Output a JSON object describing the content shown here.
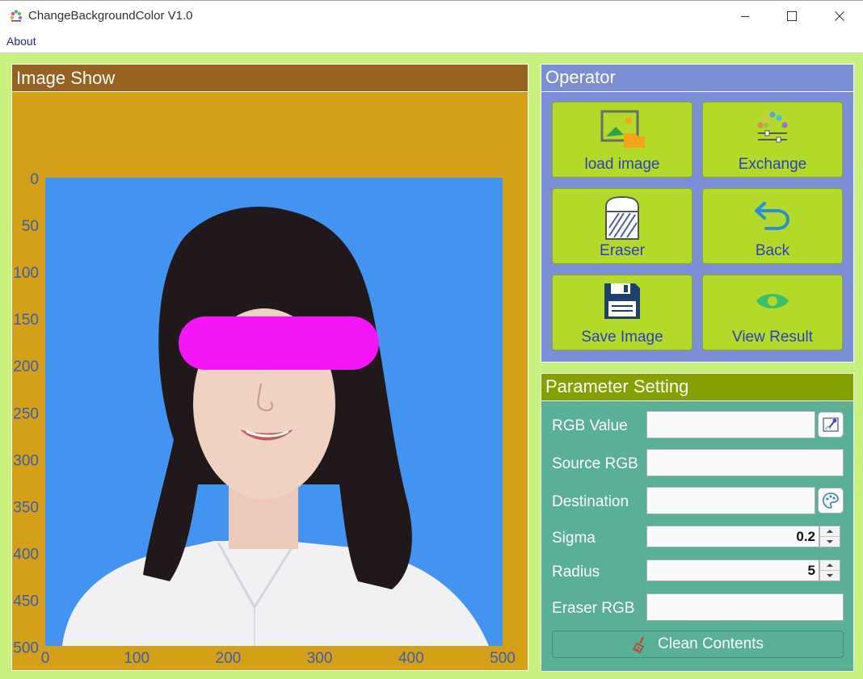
{
  "window": {
    "title": "ChangeBackgroundColor V1.0"
  },
  "menu": {
    "about": "About"
  },
  "image_panel": {
    "title": "Image Show",
    "y_ticks": [
      "0",
      "50",
      "100",
      "150",
      "200",
      "250",
      "300",
      "350",
      "400",
      "450",
      "500"
    ],
    "x_ticks": [
      "0",
      "100",
      "200",
      "300",
      "400",
      "500"
    ],
    "colors": {
      "frame": "#d4a017",
      "header": "#95621f",
      "tick": "#3a5fb0",
      "photo_bg": "#4294f0",
      "mask": "#f516f8"
    }
  },
  "operator": {
    "title": "Operator",
    "buttons": [
      {
        "label": "load image",
        "icon": "load-image-icon"
      },
      {
        "label": "Exchange",
        "icon": "exchange-icon"
      },
      {
        "label": "Eraser",
        "icon": "eraser-icon"
      },
      {
        "label": "Back",
        "icon": "back-arrow-icon"
      },
      {
        "label": "Save Image",
        "icon": "save-icon"
      },
      {
        "label": "View Result",
        "icon": "eye-icon"
      }
    ]
  },
  "parameters": {
    "title": "Parameter Setting",
    "rgb_value": {
      "label": "RGB Value",
      "value": ""
    },
    "source_rgb": {
      "label": "Source RGB",
      "value": ""
    },
    "destination": {
      "label": "Destination",
      "value": ""
    },
    "sigma": {
      "label": "Sigma",
      "value": "0.2"
    },
    "radius": {
      "label": "Radius",
      "value": "5"
    },
    "eraser_rgb": {
      "label": "Eraser RGB",
      "value": ""
    },
    "clean_button": "Clean Contents"
  }
}
